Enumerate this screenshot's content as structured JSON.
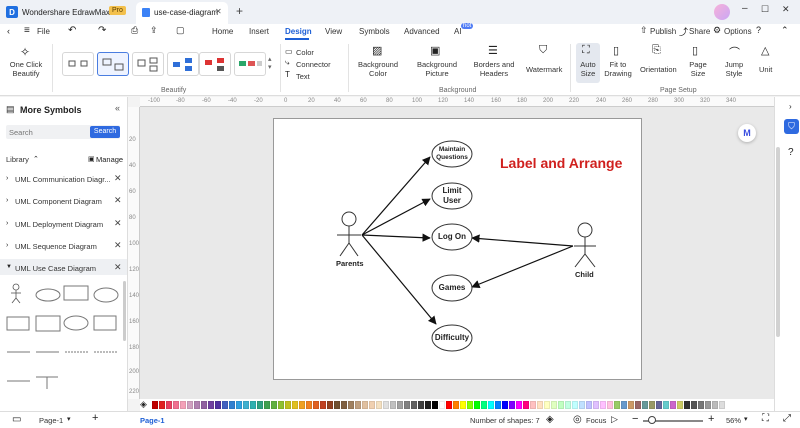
{
  "app": {
    "name": "Wondershare EdrawMax",
    "badge": "Pro",
    "tab_title": "use-case-diagram",
    "new_tab": "+",
    "file": "File"
  },
  "menu": {
    "items": [
      "Home",
      "Insert",
      "Design",
      "View",
      "Symbols",
      "Advanced",
      "AI"
    ],
    "active": "Design",
    "ai_badge": "hot",
    "publish": "Publish",
    "share": "Share",
    "options": "Options"
  },
  "ribbon": {
    "one_click_beautify": [
      "One Click",
      "Beautify"
    ],
    "color": "Color",
    "connector": "Connector",
    "text": "Text",
    "background_color": [
      "Background",
      "Color"
    ],
    "background_picture": [
      "Background",
      "Picture"
    ],
    "borders_headers": [
      "Borders and",
      "Headers"
    ],
    "watermark": "Watermark",
    "auto_size": [
      "Auto",
      "Size"
    ],
    "fit_to_drawing": [
      "Fit to",
      "Drawing"
    ],
    "orientation": "Orientation",
    "page_size": [
      "Page",
      "Size"
    ],
    "jump_style": [
      "Jump",
      "Style"
    ],
    "unit": "Unit",
    "groups": {
      "beautify": "Beautify",
      "background": "Background",
      "page_setup": "Page Setup"
    }
  },
  "left_panel": {
    "title": "More Symbols",
    "search_placeholder": "Search",
    "search_button": "Search",
    "library": "Library",
    "manage": "Manage",
    "libraries": [
      "UML Communication Diagr...",
      "UML Component Diagram",
      "UML Deployment Diagram",
      "UML Sequence Diagram",
      "UML Use Case Diagram"
    ]
  },
  "rulers": {
    "h_ticks": [
      "-100",
      "-80",
      "-60",
      "-40",
      "-20",
      "0",
      "20",
      "40",
      "60",
      "80",
      "100",
      "120",
      "140",
      "160",
      "180",
      "200",
      "220",
      "240",
      "260",
      "280",
      "300",
      "320",
      "340"
    ],
    "v_ticks": [
      "20",
      "40",
      "60",
      "80",
      "100",
      "120",
      "140",
      "160",
      "180",
      "200",
      "220"
    ]
  },
  "diagram": {
    "title": "Label and Arrange",
    "title_color": "#d0201e",
    "actors": [
      {
        "name": "Parents"
      },
      {
        "name": "Child"
      }
    ],
    "use_cases": [
      {
        "lines": [
          "Maintain",
          "Questions"
        ]
      },
      {
        "lines": [
          "Limit",
          "User"
        ]
      },
      {
        "lines": [
          "Log On"
        ]
      },
      {
        "lines": [
          "Games"
        ]
      },
      {
        "lines": [
          "Difficulty"
        ]
      }
    ]
  },
  "status": {
    "page_tab": "Page-1",
    "page_current": "Page-1",
    "shapes_label": "Number of shapes: 7",
    "focus": "Focus",
    "zoom": "56%"
  },
  "palette_colors": [
    "#c00000",
    "#e02020",
    "#e84060",
    "#f07090",
    "#f4a0b8",
    "#d0a0c0",
    "#b080b0",
    "#9060a0",
    "#7040a0",
    "#5030a0",
    "#4060c0",
    "#3080d0",
    "#30a0e0",
    "#40b0d0",
    "#30b0b0",
    "#30a080",
    "#40a050",
    "#60b040",
    "#90c030",
    "#c0c020",
    "#e0c020",
    "#f0a020",
    "#f08020",
    "#e06020",
    "#c04020",
    "#904020",
    "#705030",
    "#806040",
    "#a08060",
    "#c0a080",
    "#e0c0a0",
    "#f0d0b0",
    "#f4e0c0",
    "#e0e0e0",
    "#c0c0c0",
    "#a0a0a0",
    "#808080",
    "#606060",
    "#404040",
    "#202020",
    "#000000",
    "#ffffff",
    "#ff0000",
    "#ff8000",
    "#ffff00",
    "#80ff00",
    "#00ff00",
    "#00ff80",
    "#00ffff",
    "#0080ff",
    "#0000ff",
    "#8000ff",
    "#ff00ff",
    "#ff0080",
    "#ffc0c0",
    "#ffe0c0",
    "#ffffc0",
    "#e0ffc0",
    "#c0ffc0",
    "#c0ffe0",
    "#c0ffff",
    "#c0e0ff",
    "#c0c0ff",
    "#e0c0ff",
    "#ffc0ff",
    "#ffc0e0",
    "#9c6",
    "#69c",
    "#c96",
    "#966",
    "#699",
    "#996",
    "#669",
    "#6cc",
    "#c6c",
    "#cc6",
    "#333",
    "#555",
    "#777",
    "#999",
    "#bbb",
    "#ddd"
  ]
}
